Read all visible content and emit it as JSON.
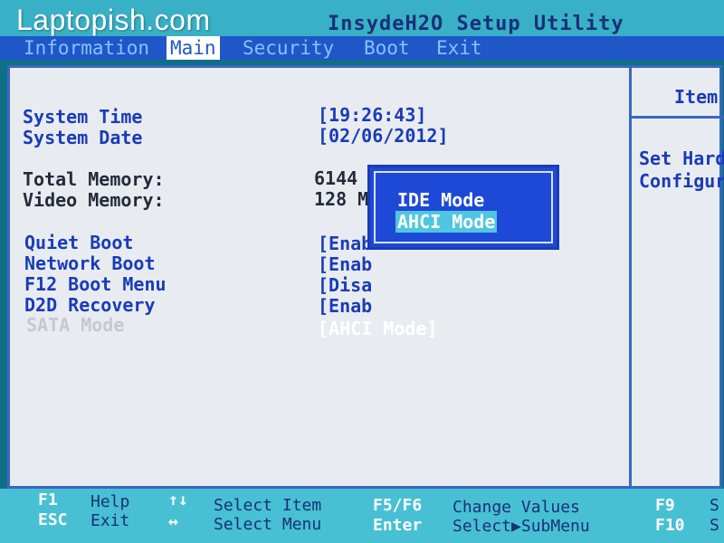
{
  "watermark": "Laptopish.com",
  "app_title": "InsydeH2O Setup Utility",
  "tabs": [
    {
      "label": "Information"
    },
    {
      "label": "Main"
    },
    {
      "label": "Security"
    },
    {
      "label": "Boot"
    },
    {
      "label": "Exit"
    }
  ],
  "settings": {
    "system_time": {
      "label": "System Time",
      "value": "[19:26:43]"
    },
    "system_date": {
      "label": "System Date",
      "value": "[02/06/2012]"
    },
    "total_memory": {
      "label": "Total Memory:",
      "value": "6144 MB"
    },
    "video_memory": {
      "label": "Video Memory:",
      "value": "128 MB"
    },
    "quiet_boot": {
      "label": "Quiet Boot",
      "value": "[Enab"
    },
    "network_boot": {
      "label": "Network Boot",
      "value": "[Enab"
    },
    "f12_boot_menu": {
      "label": "F12 Boot Menu",
      "value": "[Disa"
    },
    "d2d_recovery": {
      "label": "D2D Recovery",
      "value": "[Enab"
    },
    "sata_mode": {
      "label": "SATA Mode",
      "value": "[AHCI Mode]"
    }
  },
  "popup": {
    "options": [
      "IDE Mode",
      "AHCI Mode"
    ],
    "selected": "AHCI Mode"
  },
  "help": {
    "title": "Item",
    "line1": "Set Hard",
    "line2": "Configur"
  },
  "keys": {
    "f1": {
      "key": "F1",
      "desc": "Help"
    },
    "esc": {
      "key": "ESC",
      "desc": "Exit"
    },
    "updown": {
      "key": "↑↓",
      "desc": "Select Item"
    },
    "leftright": {
      "key": "↔",
      "desc": "Select Menu"
    },
    "f5f6": {
      "key": "F5/F6",
      "desc": "Change Values"
    },
    "enter": {
      "key": "Enter",
      "desc": "Select▶SubMenu"
    },
    "f9": {
      "key": "F9",
      "desc": "S"
    },
    "f10": {
      "key": "F10",
      "desc": "S"
    }
  },
  "colors": {
    "panel_bg": "#e8ecf1",
    "menu_bg": "#1f57c9",
    "header_bg": "#38b1c6",
    "popup_bg": "#1e49d6",
    "highlight": "#4fc6e0"
  }
}
